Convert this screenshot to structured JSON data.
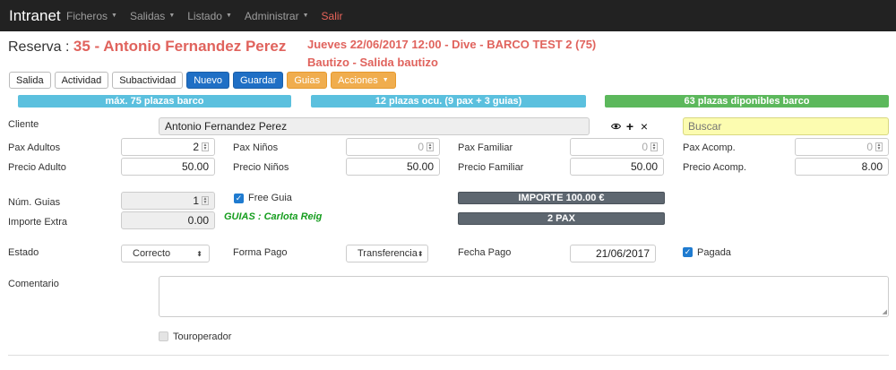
{
  "navbar": {
    "brand": "Intranet",
    "items": [
      {
        "label": "Ficheros",
        "dropdown": true
      },
      {
        "label": "Salidas",
        "dropdown": true
      },
      {
        "label": "Listado",
        "dropdown": true
      },
      {
        "label": "Administrar",
        "dropdown": true
      },
      {
        "label": "Salir",
        "dropdown": false
      }
    ],
    "caret": "▼"
  },
  "header": {
    "label": "Reserva :",
    "name": "35 - Antonio Fernandez Perez",
    "event_line1": "Jueves 22/06/2017 12:00 - Dive - BARCO TEST 2 (75)",
    "event_line2": "Bautizo - Salida bautizo"
  },
  "toolbar": {
    "salida": "Salida",
    "actividad": "Actividad",
    "subactividad": "Subactividad",
    "nuevo": "Nuevo",
    "guardar": "Guardar",
    "guias": "Guias",
    "acciones": "Acciones"
  },
  "capacity": {
    "max": "máx. 75 plazas barco",
    "occupied": "12 plazas ocu. (9 pax + 3 guias)",
    "available": "63 plazas diponibles barco"
  },
  "form": {
    "cliente_label": "Cliente",
    "cliente_value": "Antonio Fernandez Perez",
    "buscar_placeholder": "Buscar",
    "pax_adultos_label": "Pax Adultos",
    "pax_adultos": "2",
    "pax_ninos_label": "Pax Niños",
    "pax_ninos": "0",
    "pax_familiar_label": "Pax Familiar",
    "pax_familiar": "0",
    "pax_acomp_label": "Pax Acomp.",
    "pax_acomp": "0",
    "precio_adulto_label": "Precio Adulto",
    "precio_adulto": "50.00",
    "precio_ninos_label": "Precio Niños",
    "precio_ninos": "50.00",
    "precio_familiar_label": "Precio Familiar",
    "precio_familiar": "50.00",
    "precio_acomp_label": "Precio Acomp.",
    "precio_acomp": "8.00",
    "num_guias_label": "Núm. Guias",
    "num_guias": "1",
    "free_guia_label": "Free Guia",
    "free_guia_checked": true,
    "guias_text": "GUIAS : Carlota Reig",
    "importe_extra_label": "Importe Extra",
    "importe_extra": "0.00",
    "importe_total": "IMPORTE 100.00 €",
    "pax_total": "2 PAX",
    "estado_label": "Estado",
    "estado": "Correcto",
    "forma_pago_label": "Forma Pago",
    "forma_pago": "Transferencia",
    "fecha_pago_label": "Fecha Pago",
    "fecha_pago": "21/06/2017",
    "pagada_label": "Pagada",
    "pagada_checked": true,
    "comentario_label": "Comentario",
    "touroperador_label": "Touroperador",
    "touroperador_checked": false
  },
  "icons": {
    "view": "eye-icon",
    "add": "plus-icon",
    "clear": "close-icon"
  },
  "colors": {
    "accent_red": "#e0635d",
    "primary": "#1f6fc5",
    "warning": "#f0ad4e",
    "info": "#5bc0de",
    "success": "#5cb85c",
    "guias_green": "#159d1e"
  }
}
